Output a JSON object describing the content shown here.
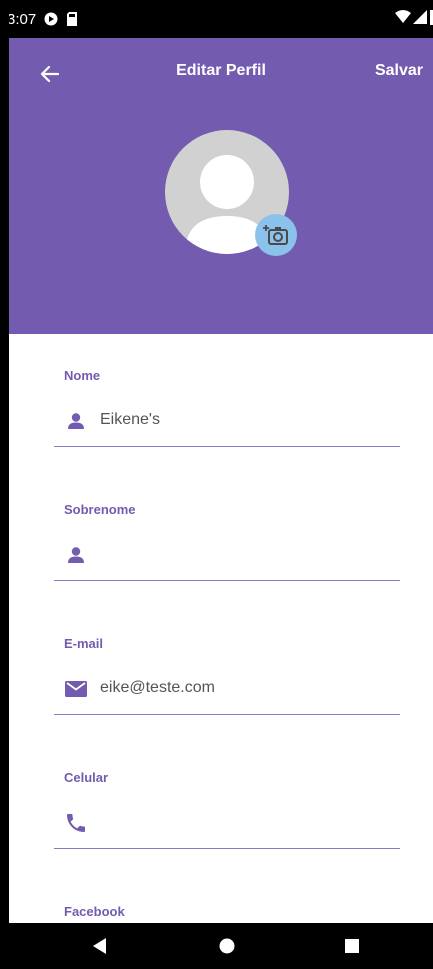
{
  "status_bar": {
    "time": "3:07"
  },
  "header": {
    "title": "Editar Perfil",
    "save_label": "Salvar"
  },
  "form": {
    "fields": [
      {
        "label": "Nome",
        "value": "Eikene's",
        "icon": "person-icon"
      },
      {
        "label": "Sobrenome",
        "value": "",
        "icon": "person-icon"
      },
      {
        "label": "E-mail",
        "value": "eike@teste.com",
        "icon": "email-icon"
      },
      {
        "label": "Celular",
        "value": "",
        "icon": "phone-icon"
      },
      {
        "label": "Facebook",
        "value": "",
        "icon": ""
      }
    ]
  },
  "colors": {
    "primary": "#735cb0",
    "camera_badge": "#8bc2ec",
    "avatar": "#d1d1d1"
  }
}
